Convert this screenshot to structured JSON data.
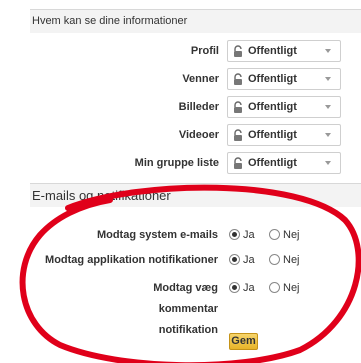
{
  "privacy_section": {
    "title": "Hvem kan se dine informationer",
    "rows": [
      {
        "label": "Profil",
        "value": "Offentligt"
      },
      {
        "label": "Venner",
        "value": "Offentligt"
      },
      {
        "label": "Billeder",
        "value": "Offentligt"
      },
      {
        "label": "Videoer",
        "value": "Offentligt"
      },
      {
        "label": "Min gruppe liste",
        "value": "Offentligt"
      }
    ]
  },
  "notifications_section": {
    "title": "E-mails og notifikationer",
    "rows": [
      {
        "label": "Modtag system e-mails",
        "selected": "Ja"
      },
      {
        "label": "Modtag applikation notifikationer",
        "selected": "Ja"
      },
      {
        "label": "Modtag væg kommentar notifikation",
        "selected": "Ja"
      }
    ],
    "option_yes": "Ja",
    "option_no": "Nej"
  },
  "save_label": "Gem",
  "colors": {
    "annotation_circle": "#e0001a",
    "save_button": "#f0c240",
    "section_header_bg": "#f3f3f3"
  }
}
